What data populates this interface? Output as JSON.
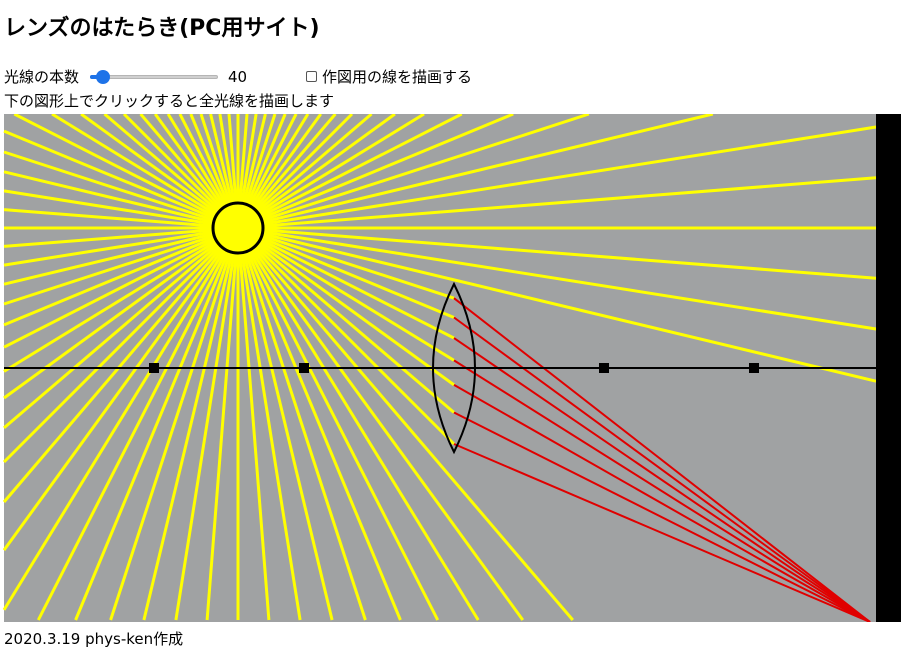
{
  "title": "レンズのはたらき(PC用サイト)",
  "controls": {
    "rays_label": "光線の本数",
    "rays_count": 40,
    "rays_count_text": "40",
    "rays_fraction": 0.05,
    "construction_lines_label": "作図用の線を描画する",
    "construction_lines_checked": false
  },
  "hint": "下の図形上でクリックすると全光線を描画します",
  "footer": "2020.3.19 phys-ken作成",
  "colors": {
    "background": "#a0a2a3",
    "screen": "#000000",
    "ray": "#ffff00",
    "refracted_ray": "#e00000",
    "source_fill": "#ffff00",
    "accent": "#1e73e8"
  }
}
